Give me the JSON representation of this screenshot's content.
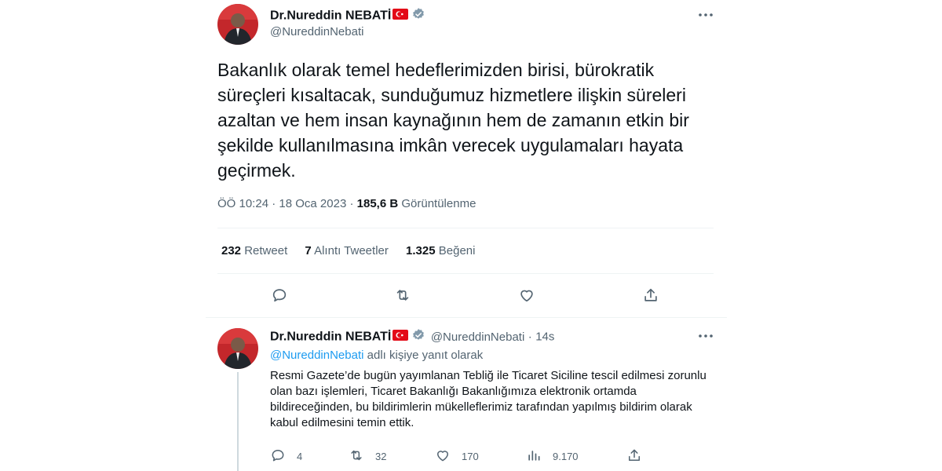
{
  "main_tweet": {
    "author_name": "Dr.Nureddin NEBATİ",
    "handle": "@NureddinNebati",
    "text": "Bakanlık olarak temel hedeflerimizden birisi, bürokratik süreçleri kısaltacak, sunduğumuz hizmetlere ilişkin süreleri azaltan ve hem insan kaynağının hem de zamanın etkin bir şekilde kullanılmasına imkân verecek uygulamaları hayata geçirmek.",
    "time": "ÖÖ 10:24",
    "separator": "·",
    "date": "18 Oca 2023",
    "views_count": "185,6 B",
    "views_label": "Görüntülenme",
    "stats": {
      "retweet_count": "232",
      "retweet_label": "Retweet",
      "quote_count": "7",
      "quote_label": "Alıntı Tweetler",
      "like_count": "1.325",
      "like_label": "Beğeni"
    }
  },
  "reply_tweet": {
    "author_name": "Dr.Nureddin NEBATİ",
    "handle": "@NureddinNebati",
    "separator": "·",
    "age": "14s",
    "reply_to_handle": "@NureddinNebati",
    "reply_to_suffix": "adlı kişiye yanıt olarak",
    "text": "Resmi Gazete’de bugün yayımlanan Tebliğ ile Ticaret Siciline tescil edilmesi zorunlu olan bazı işlemleri, Ticaret Bakanlığı Bakanlığımıza elektronik ortamda bildireceğinden, bu bildirimlerin mükelleflerimiz tarafından yapılmış bildirim olarak kabul edilmesini temin ettik.",
    "replies": "4",
    "retweets": "32",
    "likes": "170",
    "views": "9.170"
  },
  "icons": [
    "verified-badge-icon",
    "turkish-flag-icon",
    "more-icon",
    "reply-icon",
    "retweet-icon",
    "like-icon",
    "share-icon",
    "views-icon"
  ],
  "colors": {
    "link": "#1d9bf0",
    "secondary": "#536471",
    "verified": "#829aab",
    "flag": "#e30a17"
  }
}
